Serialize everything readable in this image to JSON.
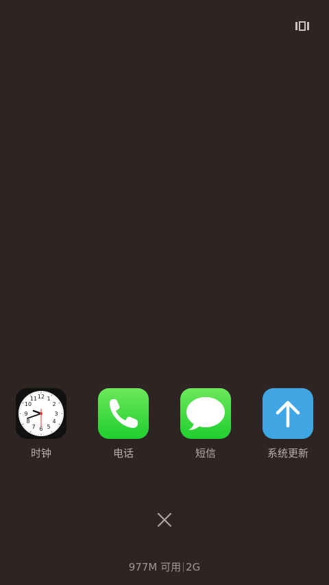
{
  "recents": {
    "apps": [
      {
        "label": "时钟",
        "icon": "clock-icon"
      },
      {
        "label": "电话",
        "icon": "phone-icon"
      },
      {
        "label": "短信",
        "icon": "messages-icon"
      },
      {
        "label": "系统更新",
        "icon": "arrow-up-icon"
      }
    ],
    "clock_numbers": [
      "12",
      "1",
      "2",
      "3",
      "4",
      "5",
      "6",
      "7",
      "8",
      "9",
      "10",
      "11"
    ]
  },
  "footer": {
    "memory_text": "977M 可用",
    "total_text": "2G"
  },
  "colors": {
    "background": "#2e2423",
    "label": "#b7b0ae",
    "green": "#2fd63a",
    "blue": "#3fa6e3"
  }
}
